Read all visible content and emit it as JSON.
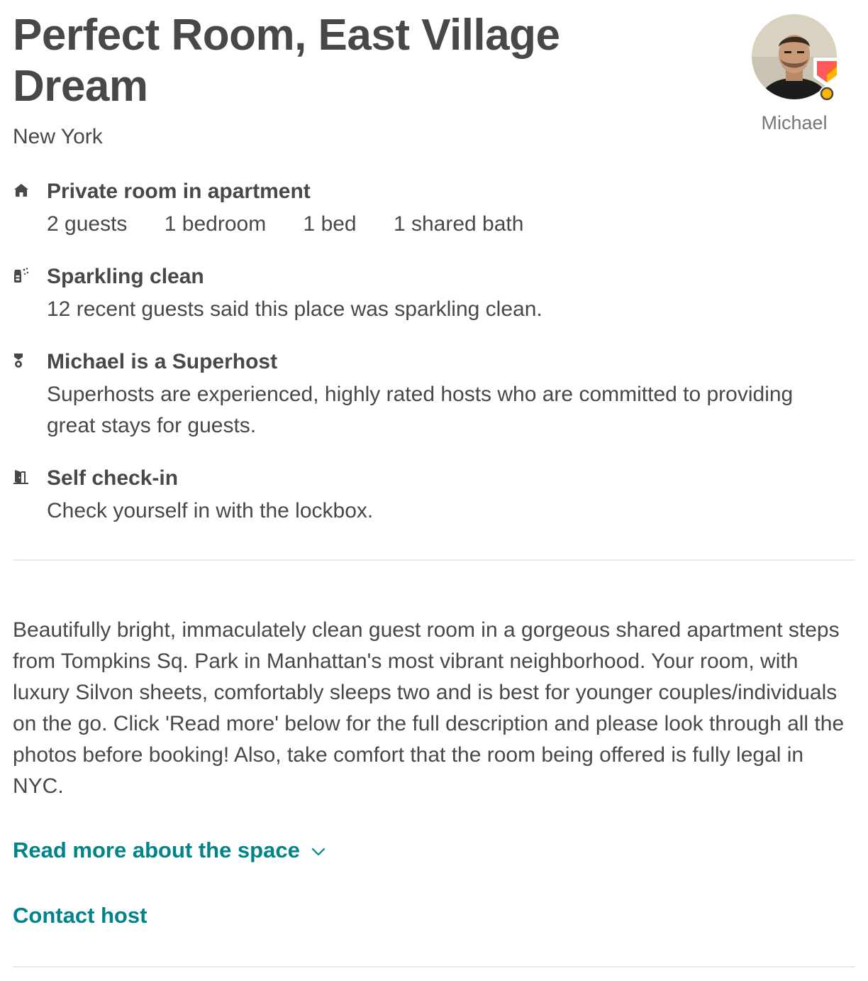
{
  "listing": {
    "title": "Perfect Room, East Village Dream",
    "location": "New York"
  },
  "host": {
    "name": "Michael",
    "avatar_icon": "host-avatar-photo",
    "badge_icon": "superhost-badge-icon"
  },
  "features": [
    {
      "icon": "home-icon",
      "title": "Private room in apartment",
      "specs": [
        "2 guests",
        "1 bedroom",
        "1 bed",
        "1 shared bath"
      ]
    },
    {
      "icon": "sparkle-spray-icon",
      "title": "Sparkling clean",
      "description": "12 recent guests said this place was sparkling clean."
    },
    {
      "icon": "superhost-medal-icon",
      "title": "Michael is a Superhost",
      "description": "Superhosts are experienced, highly rated hosts who are committed to providing great stays for guests."
    },
    {
      "icon": "door-icon",
      "title": "Self check-in",
      "description": "Check yourself in with the lockbox."
    }
  ],
  "description": "Beautifully bright, immaculately clean guest room in a gorgeous shared apartment steps from Tompkins Sq. Park in Manhattan's most vibrant neighborhood. Your room, with luxury Silvon sheets, comfortably sleeps two and is best for younger couples/individuals on the go. Click 'Read more' below for the full description and please look through all the photos before booking! Also, take comfort that the room being offered is fully legal in NYC.",
  "links": {
    "read_more": "Read more about the space",
    "contact_host": "Contact host"
  },
  "colors": {
    "text": "#484848",
    "muted": "#767676",
    "link": "#008489",
    "divider": "#ebebeb",
    "badge_red": "#ff5a5f",
    "badge_yellow": "#ffb400"
  }
}
